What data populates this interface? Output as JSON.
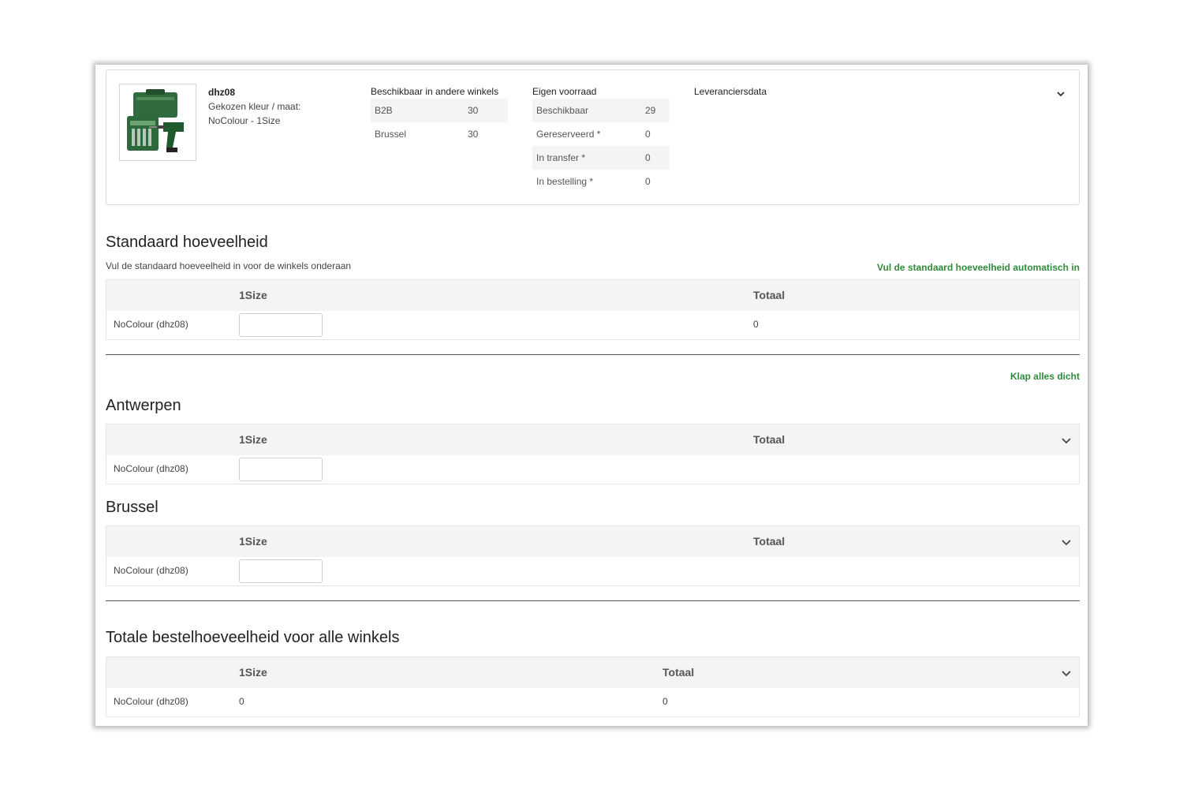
{
  "product": {
    "image_alt": "drill-case-product-image",
    "sku": "dhz08",
    "chosen_label": "Gekozen kleur / maat:",
    "chosen_value": "NoColour - 1Size"
  },
  "availability": {
    "title": "Beschikbaar in andere winkels",
    "rows": [
      {
        "label": "B2B",
        "value": "30"
      },
      {
        "label": "Brussel",
        "value": "30"
      }
    ]
  },
  "own_stock": {
    "title": "Eigen voorraad",
    "rows": [
      {
        "label": "Beschikbaar",
        "value": "29"
      },
      {
        "label": "Gereserveerd *",
        "value": "0"
      },
      {
        "label": "In transfer *",
        "value": "0"
      },
      {
        "label": "In bestelling *",
        "value": "0"
      }
    ]
  },
  "supplier": {
    "title": "Leveranciersdata"
  },
  "standard": {
    "title": "Standaard hoeveelheid",
    "subtitle": "Vul de standaard hoeveelheid in voor de winkels onderaan",
    "autofill_link": "Vul de standaard hoeveelheid automatisch in",
    "col_size": "1Size",
    "col_total": "Totaal",
    "row_label": "NoColour (dhz08)",
    "row_total": "0"
  },
  "collapse_all": "Klap alles dicht",
  "stores": [
    {
      "name": "Antwerpen",
      "col_size": "1Size",
      "col_total": "Totaal",
      "row_label": "NoColour (dhz08)"
    },
    {
      "name": "Brussel",
      "col_size": "1Size",
      "col_total": "Totaal",
      "row_label": "NoColour (dhz08)"
    }
  ],
  "grand_total": {
    "title": "Totale bestelhoeveelheid voor alle winkels",
    "col_size": "1Size",
    "col_total": "Totaal",
    "row_label": "NoColour (dhz08)",
    "row_size_value": "0",
    "row_total": "0"
  },
  "colors": {
    "accent_green": "#2e8b3a",
    "header_gray": "#f4f4f4"
  }
}
